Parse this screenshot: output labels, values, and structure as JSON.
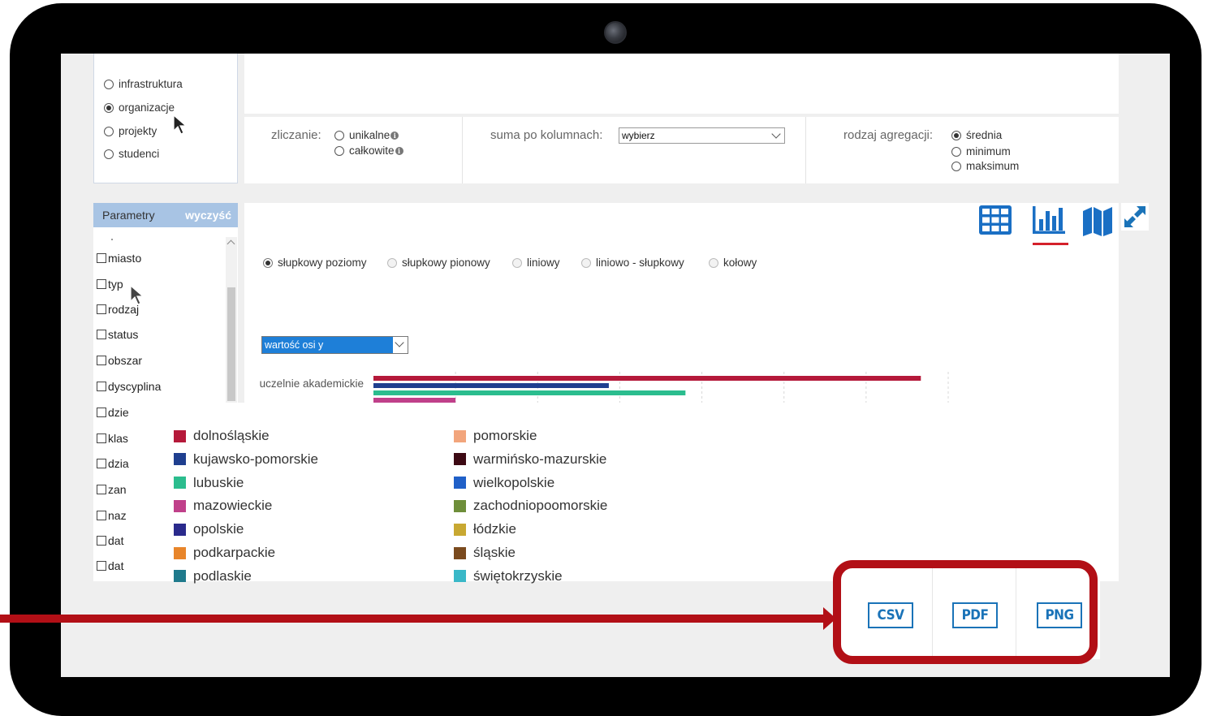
{
  "sidebar_radios": {
    "items": [
      {
        "label": "infrastruktura",
        "checked": false
      },
      {
        "label": "organizacje",
        "checked": true
      },
      {
        "label": "projekty",
        "checked": false
      },
      {
        "label": "studenci",
        "checked": false
      }
    ]
  },
  "controls": {
    "counting_label": "zliczanie:",
    "counting_options": [
      "unikalne",
      "całkowite"
    ],
    "info_glyph": "i",
    "sum_label": "suma po kolumnach:",
    "sum_value": "wybierz",
    "aggregation_label": "rodzaj agregacji:",
    "aggregation_options": [
      {
        "label": "średnia",
        "checked": true
      },
      {
        "label": "minimum",
        "checked": false
      },
      {
        "label": "maksimum",
        "checked": false
      }
    ]
  },
  "parameters": {
    "title": "Parametry",
    "clear_label": "wyczyść",
    "items": [
      "miasto",
      "typ",
      "rodzaj",
      "status",
      "obszar",
      "dyscyplina",
      "dzie",
      "klas",
      "dzia",
      "zan",
      "naz",
      "dat",
      "dat"
    ]
  },
  "chart_types": [
    {
      "label": "słupkowy poziomy",
      "checked": true
    },
    {
      "label": "słupkowy pionowy",
      "checked": false
    },
    {
      "label": "liniowy",
      "checked": false
    },
    {
      "label": "liniowo - słupkowy",
      "checked": false
    },
    {
      "label": "kołowy",
      "checked": false
    }
  ],
  "y_axis_select": {
    "value": "wartość osi y",
    "selected_bg": "#1e7fd8"
  },
  "view_icons": [
    "table-view-icon",
    "bar-chart-view-icon",
    "map-view-icon",
    "expand-icon"
  ],
  "chart_data": {
    "type": "bar",
    "orientation": "horizontal",
    "categories": [
      "uczelnie akademickie"
    ],
    "series": [
      {
        "name": "dolnośląskie",
        "values": [
          100
        ],
        "color": "#b5193a"
      },
      {
        "name": "kujawsko-pomorskie",
        "values": [
          43
        ],
        "color": "#1f3f8f"
      },
      {
        "name": "lubuskie",
        "values": [
          57
        ],
        "color": "#2bbd8e"
      },
      {
        "name": "mazowieckie",
        "values": [
          15
        ],
        "color": "#c0408a"
      }
    ],
    "xlim": [
      0,
      105
    ]
  },
  "legend": {
    "items": [
      {
        "label": "dolnośląskie",
        "color": "#b5193a"
      },
      {
        "label": "kujawsko-pomorskie",
        "color": "#1f3f8f"
      },
      {
        "label": "lubuskie",
        "color": "#2bbd8e"
      },
      {
        "label": "mazowieckie",
        "color": "#c0408a"
      },
      {
        "label": "opolskie",
        "color": "#2a2a8c"
      },
      {
        "label": "podkarpackie",
        "color": "#e8852a"
      },
      {
        "label": "podlaskie",
        "color": "#1f7a8c"
      },
      {
        "label": "pomorskie",
        "color": "#f2a57c"
      },
      {
        "label": "warmińsko-mazurskie",
        "color": "#3d0a14"
      },
      {
        "label": "wielkopolskie",
        "color": "#2060c8"
      },
      {
        "label": "zachodniopoomorskie",
        "color": "#6e8e3a"
      },
      {
        "label": "łódzkie",
        "color": "#c8a832"
      },
      {
        "label": "śląskie",
        "color": "#7a4a1e"
      },
      {
        "label": "świętokrzyskie",
        "color": "#3ab8c8"
      }
    ]
  },
  "export": {
    "buttons": [
      "CSV",
      "PDF",
      "PNG"
    ],
    "color": "#1a73b8"
  },
  "annotation": {
    "highlight_color": "#b20f16"
  }
}
